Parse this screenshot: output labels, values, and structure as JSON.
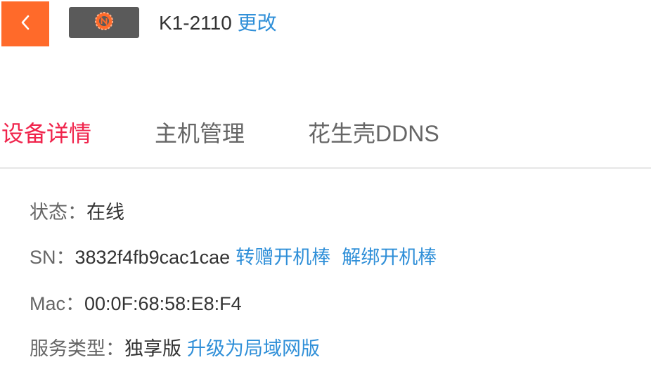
{
  "header": {
    "device_model": "K1-2110",
    "change_link": "更改",
    "colors": {
      "back_button_bg": "#ff6a2a",
      "logo_bg": "#5a5a5a",
      "logo_mark": "#ff6a2a"
    }
  },
  "tabs": [
    {
      "label": "设备详情",
      "active": true
    },
    {
      "label": "主机管理",
      "active": false
    },
    {
      "label": "花生壳DDNS",
      "active": false
    }
  ],
  "details": {
    "status": {
      "label": "状态：",
      "value": "在线"
    },
    "sn": {
      "label": "SN：",
      "value": "3832f4fb9cac1cae",
      "transfer_link": "转赠开机棒",
      "unbind_link": "解绑开机棒"
    },
    "mac": {
      "label": "Mac：",
      "value": "00:0F:68:58:E8:F4"
    },
    "service_type": {
      "label": "服务类型：",
      "value": "独享版",
      "upgrade_link": "升级为局域网版"
    }
  },
  "colors": {
    "accent_tab": "#f0244c",
    "link": "#2f8fd8",
    "label": "#666666",
    "value": "#333333",
    "divider": "#e6e6e6"
  }
}
